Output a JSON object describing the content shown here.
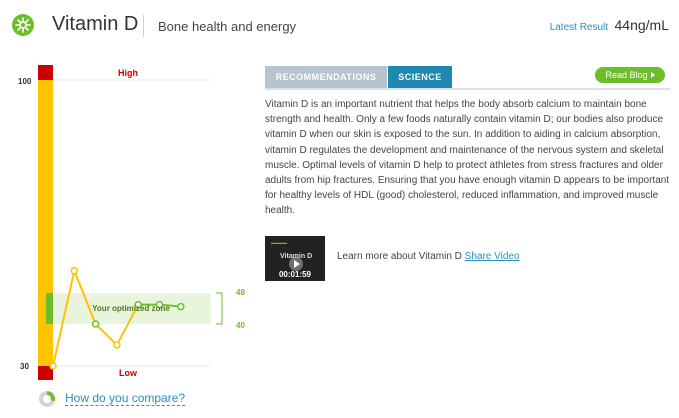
{
  "header": {
    "title": "Vitamin D",
    "subtitle": "Bone health and energy",
    "latest_label": "Latest Result",
    "latest_value": "44ng/mL",
    "logo_icon": "leaf-logo-icon"
  },
  "gauge": {
    "y_max_label": "100",
    "y_min_label": "30",
    "high_label": "High",
    "low_label": "Low",
    "zone_label": "Your optimized zone",
    "zone_high_label": "48",
    "zone_low_label": "40",
    "colors": {
      "high": "#cc0000",
      "normal": "#ffc400",
      "optimal": "#6cbf2a",
      "zone_bg": "#e9f4dc"
    }
  },
  "chart_data": {
    "type": "line",
    "y_scale": "zone-segmented",
    "zone": [
      40,
      48
    ],
    "series": [
      {
        "values": [
          30,
          51,
          40,
          35,
          45,
          45,
          44.5
        ]
      }
    ]
  },
  "compare": {
    "label": "How do you compare?",
    "icon": "pie-chart-icon"
  },
  "tabs": [
    {
      "label": "RECOMMENDATIONS",
      "active": false
    },
    {
      "label": "SCIENCE",
      "active": true
    }
  ],
  "blog_button": {
    "label": "Read Blog"
  },
  "science_text": "Vitamin D is an important nutrient that helps the body absorb calcium to maintain bone strength and health. Only a few foods naturally contain vitamin D; our bodies also produce vitamin D when our skin is exposed to the sun. In addition to aiding in calcium absorption, vitamin D regulates the development and maintenance of the nervous system and skeletal muscle. Optimal levels of vitamin D help to protect athletes from stress fractures and older adults from hip fractures. Ensuring that you have enough vitamin D appears to be important for healthy levels of HDL (good) cholesterol, reduced inflammation, and improved muscle health.",
  "video": {
    "title": "Vitamin D",
    "duration": "00:01:59",
    "caption": "Learn more about Vitamin D",
    "share_label": "Share Video",
    "play_icon": "play-icon"
  }
}
